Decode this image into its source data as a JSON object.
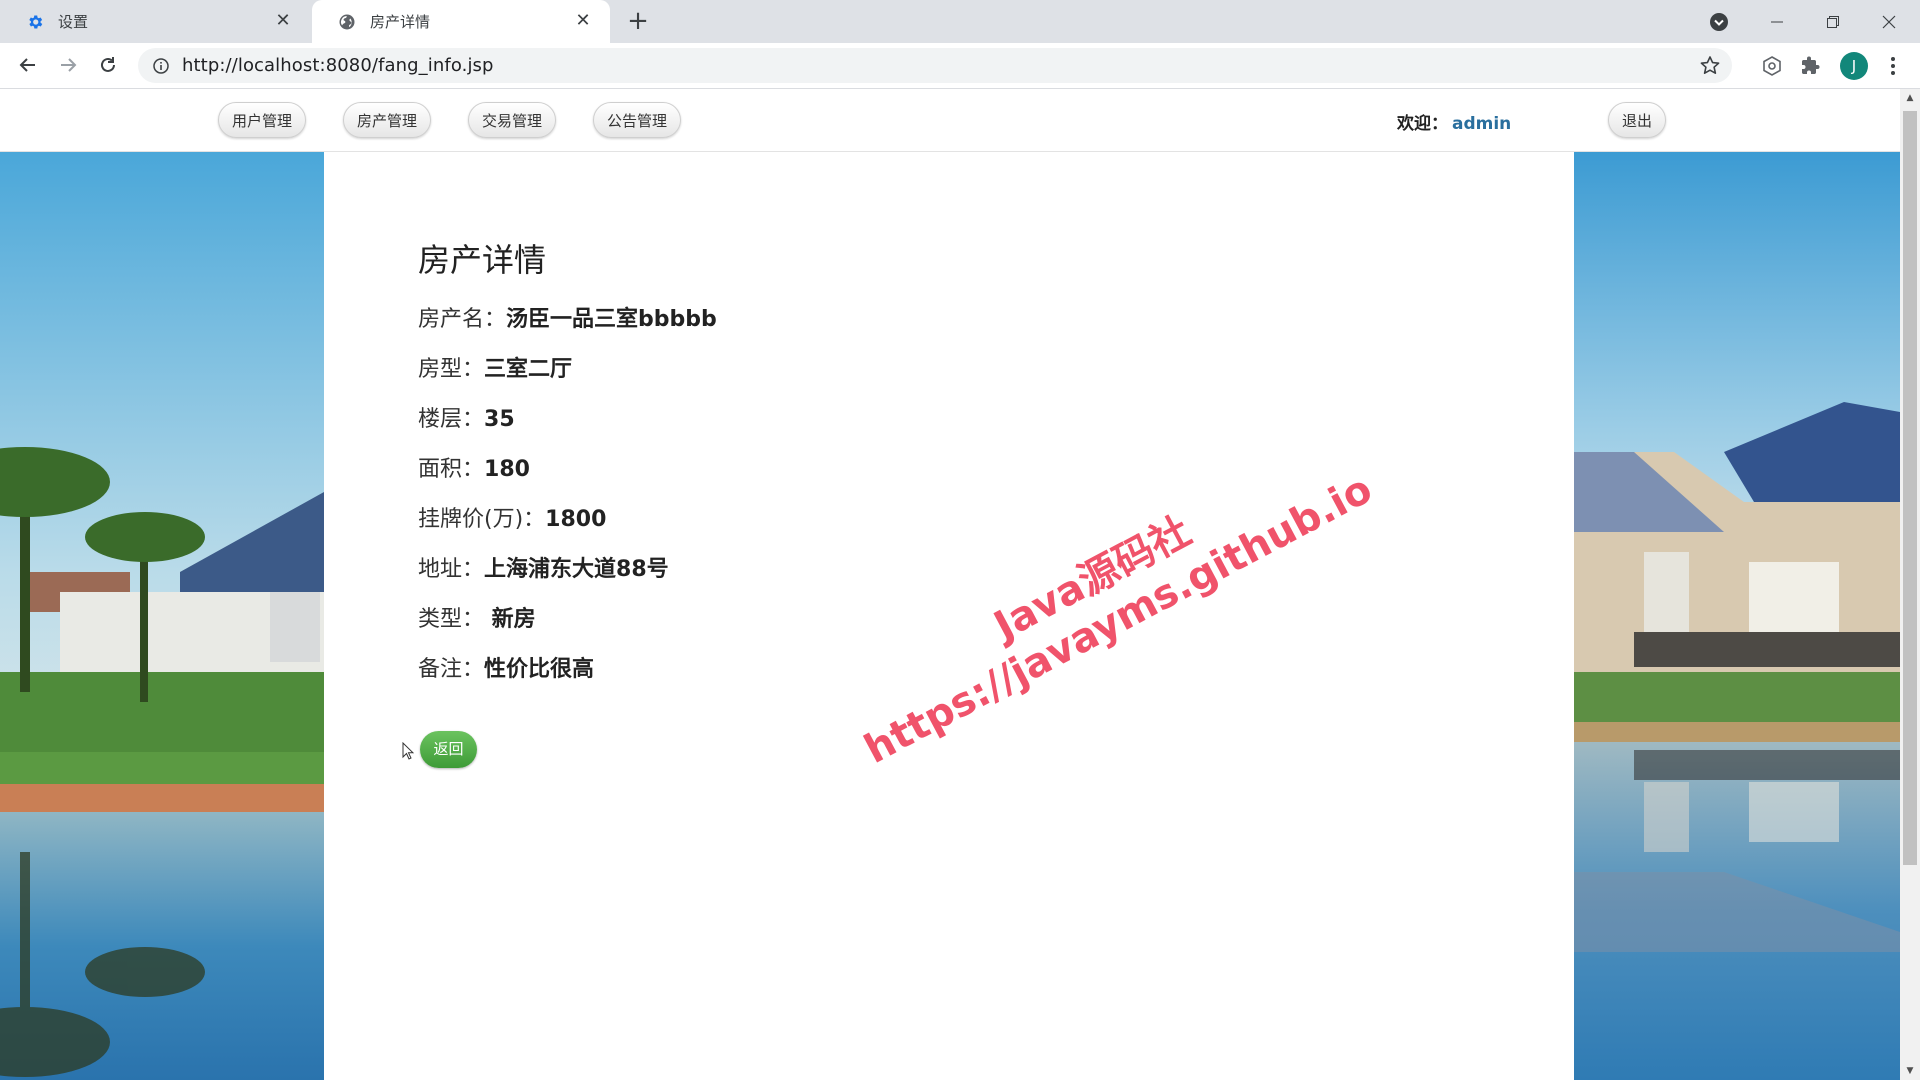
{
  "browser": {
    "tabs": [
      {
        "title": "设置",
        "icon": "gear-icon"
      },
      {
        "title": "房产详情",
        "icon": "globe-icon",
        "active": true
      }
    ],
    "url": "http://localhost:8080/fang_info.jsp",
    "profile_initial": "J"
  },
  "header": {
    "menu": [
      {
        "label": "用户管理"
      },
      {
        "label": "房产管理"
      },
      {
        "label": "交易管理"
      },
      {
        "label": "公告管理"
      }
    ],
    "welcome_label": "欢迎：",
    "username": "admin",
    "logout_label": "退出"
  },
  "detail": {
    "title": "房产详情",
    "fields": [
      {
        "label": "房产名：",
        "value": "汤臣一品三室bbbbb"
      },
      {
        "label": "房型：",
        "value": "三室二厅"
      },
      {
        "label": "楼层：",
        "value": "35"
      },
      {
        "label": "面积：",
        "value": "180"
      },
      {
        "label": "挂牌价(万)：",
        "value": "1800"
      },
      {
        "label": "地址：",
        "value": "上海浦东大道88号"
      },
      {
        "label": "类型：",
        "value": " 新房"
      },
      {
        "label": "备注：",
        "value": "性价比很高"
      }
    ],
    "back_label": "返回"
  },
  "watermark": {
    "line1": "Java源码社",
    "line2": "https://javayms.github.io"
  },
  "colors": {
    "accent_green": "#4cae45",
    "username_blue": "#2a6f9e",
    "watermark_red": "#ec2846"
  }
}
